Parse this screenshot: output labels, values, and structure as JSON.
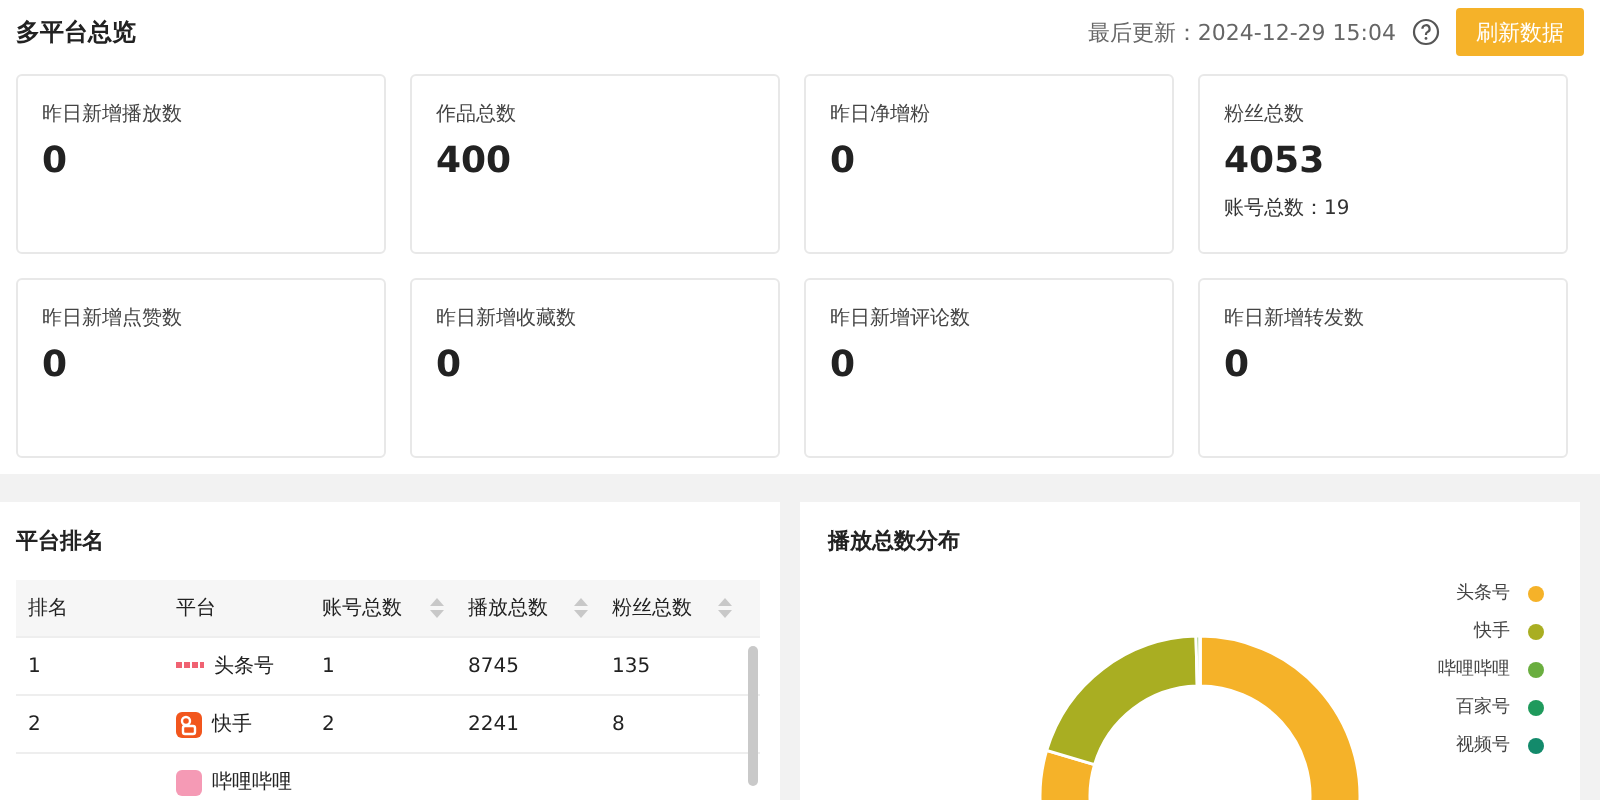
{
  "header": {
    "title": "多平台总览",
    "last_updated": "最后更新：2024-12-29 15:04",
    "refresh_button": "刷新数据"
  },
  "stats": [
    {
      "label": "昨日新增播放数",
      "value": "0"
    },
    {
      "label": "作品总数",
      "value": "400"
    },
    {
      "label": "昨日净增粉",
      "value": "0"
    },
    {
      "label": "粉丝总数",
      "value": "4053",
      "sub": "账号总数：19"
    },
    {
      "label": "昨日新增点赞数",
      "value": "0"
    },
    {
      "label": "昨日新增收藏数",
      "value": "0"
    },
    {
      "label": "昨日新增评论数",
      "value": "0"
    },
    {
      "label": "昨日新增转发数",
      "value": "0"
    }
  ],
  "ranking": {
    "title": "平台排名",
    "columns": [
      {
        "label": "排名",
        "sortable": false
      },
      {
        "label": "平台",
        "sortable": false
      },
      {
        "label": "账号总数",
        "sortable": true
      },
      {
        "label": "播放总数",
        "sortable": true
      },
      {
        "label": "粉丝总数",
        "sortable": true
      }
    ],
    "rows": [
      {
        "rank": "1",
        "platform": "头条号",
        "accounts": "1",
        "plays": "8745",
        "fans": "135"
      },
      {
        "rank": "2",
        "platform": "快手",
        "accounts": "2",
        "plays": "2241",
        "fans": "8"
      },
      {
        "rank": "",
        "platform": "哔哩哔哩",
        "accounts": "",
        "plays": "",
        "fans": ""
      }
    ]
  },
  "distribution": {
    "title": "播放总数分布",
    "chart_data": {
      "type": "donut",
      "categories": [
        "头条号",
        "快手",
        "哔哩哔哩",
        "百家号",
        "视频号"
      ],
      "values": [
        79.6,
        20.0,
        0.4,
        0,
        0
      ],
      "legend": "right",
      "colors": [
        "#f5b229",
        "#a9ae22",
        "#6aae3f",
        "#1f9a5c",
        "#138a6b"
      ]
    }
  }
}
